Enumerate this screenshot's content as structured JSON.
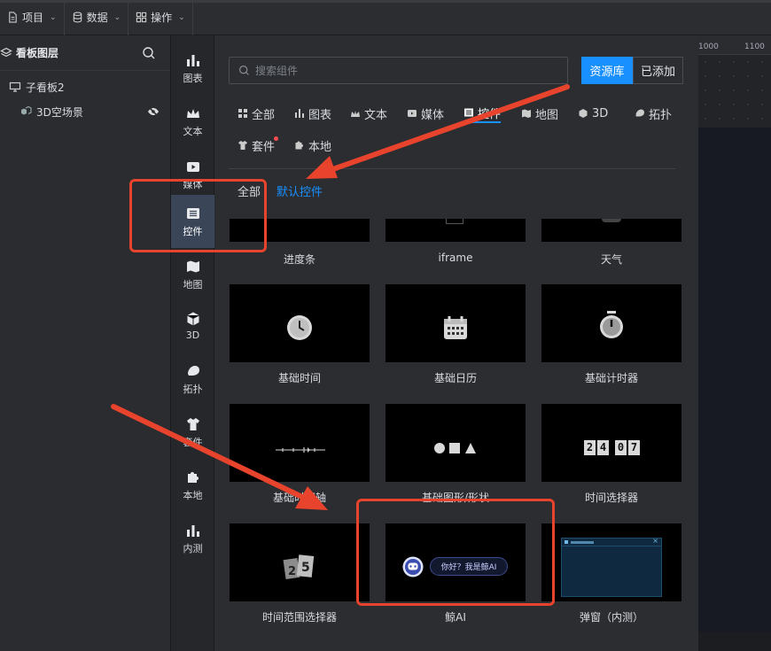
{
  "menubar": {
    "project": "项目",
    "data": "数据",
    "operate": "操作"
  },
  "layers": {
    "title": "看板图层",
    "items": [
      {
        "label": "子看板2",
        "icon": "monitor-icon"
      },
      {
        "label": "3D空场景",
        "icon": "cube-group-icon"
      }
    ]
  },
  "categories": [
    {
      "label": "图表",
      "icon": "bar-chart-icon"
    },
    {
      "label": "文本",
      "icon": "crown-icon"
    },
    {
      "label": "媒体",
      "icon": "media-icon"
    },
    {
      "label": "控件",
      "icon": "widget-icon",
      "active": true
    },
    {
      "label": "地图",
      "icon": "map-icon"
    },
    {
      "label": "3D",
      "icon": "cube-icon"
    },
    {
      "label": "拓扑",
      "icon": "topology-icon"
    },
    {
      "label": "套件",
      "icon": "shirt-icon"
    },
    {
      "label": "本地",
      "icon": "puzzle-icon"
    },
    {
      "label": "内测",
      "icon": "bar-chart-icon"
    }
  ],
  "panel": {
    "search_placeholder": "搜索组件",
    "resource_btn": "资源库",
    "added_btn": "已添加",
    "tabs": [
      {
        "label": "全部"
      },
      {
        "label": "图表"
      },
      {
        "label": "文本"
      },
      {
        "label": "媒体"
      },
      {
        "label": "控件",
        "active": true
      },
      {
        "label": "地图"
      },
      {
        "label": "3D"
      },
      {
        "label": "拓扑"
      },
      {
        "label": "套件",
        "badge": true
      },
      {
        "label": "本地"
      }
    ],
    "subfilters": [
      {
        "label": "全部"
      },
      {
        "label": "默认控件",
        "active": true
      }
    ],
    "cards": [
      {
        "label": "进度条"
      },
      {
        "label": "iframe"
      },
      {
        "label": "天气"
      },
      {
        "label": "基础时间"
      },
      {
        "label": "基础日历"
      },
      {
        "label": "基础计时器"
      },
      {
        "label": "基础时间轴"
      },
      {
        "label": "基础图形/形状"
      },
      {
        "label": "时间选择器"
      },
      {
        "label": "时间范围选择器"
      },
      {
        "label": "鲸AI"
      },
      {
        "label": "弹窗（内测）"
      }
    ],
    "ai_bubble": "你好？我是鲸AI",
    "timer_digits": [
      "2",
      "4",
      "0",
      "7"
    ]
  },
  "canvas": {
    "ruler_ticks": [
      "1000",
      "1100"
    ]
  },
  "colors": {
    "accent": "#1890ff",
    "annotation": "#e8432c",
    "active_category": "#3a4658"
  }
}
